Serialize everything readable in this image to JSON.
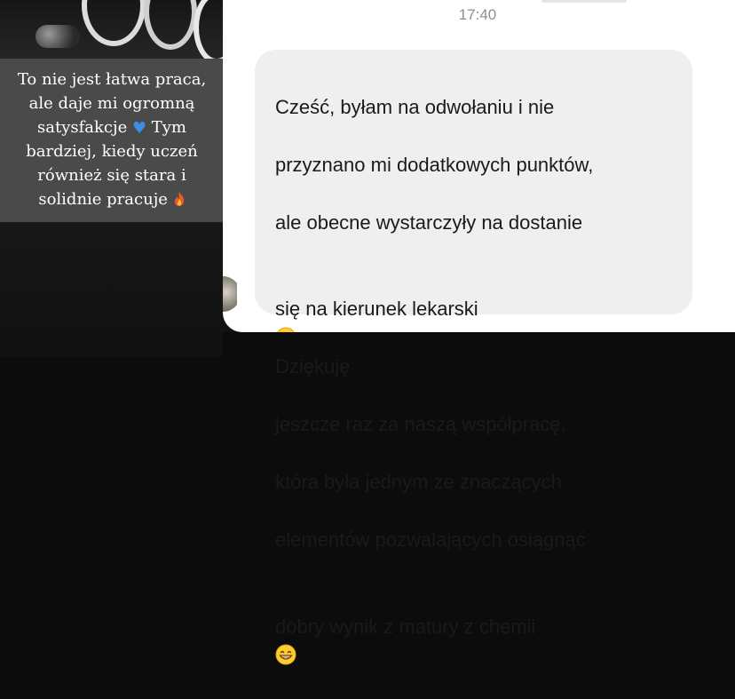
{
  "story": {
    "caption_lines": [
      "To nie jest łatwa praca,",
      "ale daje mi ogromną",
      "satysfakcje",
      "Tym",
      "bardziej, kiedy uczeń",
      "również się stara i",
      "solidnie pracuje"
    ],
    "heart_icon": "blue-heart-icon",
    "heart_color": "#3a8ee6",
    "fire_icon": "fire-icon"
  },
  "chat": {
    "timestamp": "17:40",
    "message_lines": [
      "Cześć, byłam na odwołaniu i nie",
      "przyznano mi dodatkowych punktów,",
      "ale obecne wystarczyły na dostanie",
      "się na kierunek lekarski",
      "Dziękuję",
      "jeszcze raz za naszą współpracę,",
      "która była jednym ze znaczących",
      "elementów pozwalających osiągnąć",
      "dobry wynik z matury z chemii"
    ],
    "emoji_1": "smiling-face-icon",
    "emoji_2": "grinning-face-icon",
    "bubble_color": "#efefef"
  }
}
